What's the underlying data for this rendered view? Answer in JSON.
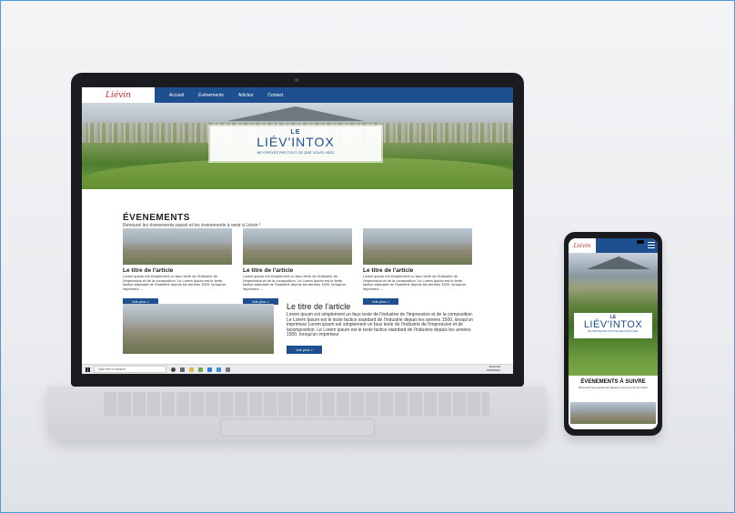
{
  "site": {
    "logo_text": "Liévin",
    "nav": [
      "Accueil",
      "Évènements",
      "Articles",
      "Contact"
    ]
  },
  "hero": {
    "line1": "LE",
    "line2": "LIÉV'INTOX",
    "tagline": "NE CROYEZ PAS TOUT CE QUE VOUS LISEZ"
  },
  "events": {
    "title": "ÉVENEMENTS",
    "subtitle": "Retrouvé les évenements passé et les évenements à venir à Liévin !",
    "cards": [
      {
        "title": "Le titre de l'article",
        "text": "Lorem ipsum est simplement un faux texte de l'industrie de l'impression et de la composition. Le Lorem Ipsum est le texte factice standard de l'industrie depuis les années 1500, lorsqu'un imprimeur ...",
        "button": "Voir plus >"
      },
      {
        "title": "Le titre de l'article",
        "text": "Lorem ipsum est simplement un faux texte de l'industrie de l'impression et de la composition. Le Lorem Ipsum est le texte factice standard de l'industrie depuis les années 1500, lorsqu'un imprimeur ...",
        "button": "Voir plus >"
      },
      {
        "title": "Le titre de l'article",
        "text": "Lorem ipsum est simplement un faux texte de l'industrie de l'impression et de la composition. Le Lorem Ipsum est le texte factice standard de l'industrie depuis les années 1500, lorsqu'un imprimeur ...",
        "button": "Voir plus >"
      }
    ],
    "featured": {
      "title": "Le titre de l'article",
      "text": "Lorem ipsum est simplement un faux texte de l'industrie de l'impression et de la composition. Le Lorem Ipsum est le texte factice standard de l'industrie depuis les années 1500, lorsqu'un imprimeur Lorem ipsum est simplement un faux texte de l'industrie de l'impression et de lacomposition. Le Lorem ipsum est le texte factice standard de l'industrie depuis les années 1500, lorsqu'un imprimeur",
      "button": "Voir plus >"
    }
  },
  "taskbar": {
    "search_placeholder": "Type here to search",
    "time": "10:32 AM",
    "date": "10/02/2021"
  },
  "phone": {
    "logo_text": "Liévin",
    "hero_line1": "LE",
    "hero_line2": "LIÉV'INTOX",
    "hero_tagline": "NE CROYEZ PAS TOUT CE QUE VOUS LISEZ",
    "events_title": "ÉVENEMENTS À SUIVRE",
    "events_subtitle": "Retrouvez les évènement passé et ceux à venir de Liévin"
  },
  "colors": {
    "brand_blue": "#1e4f8f",
    "logo_red": "#c62b2b"
  }
}
